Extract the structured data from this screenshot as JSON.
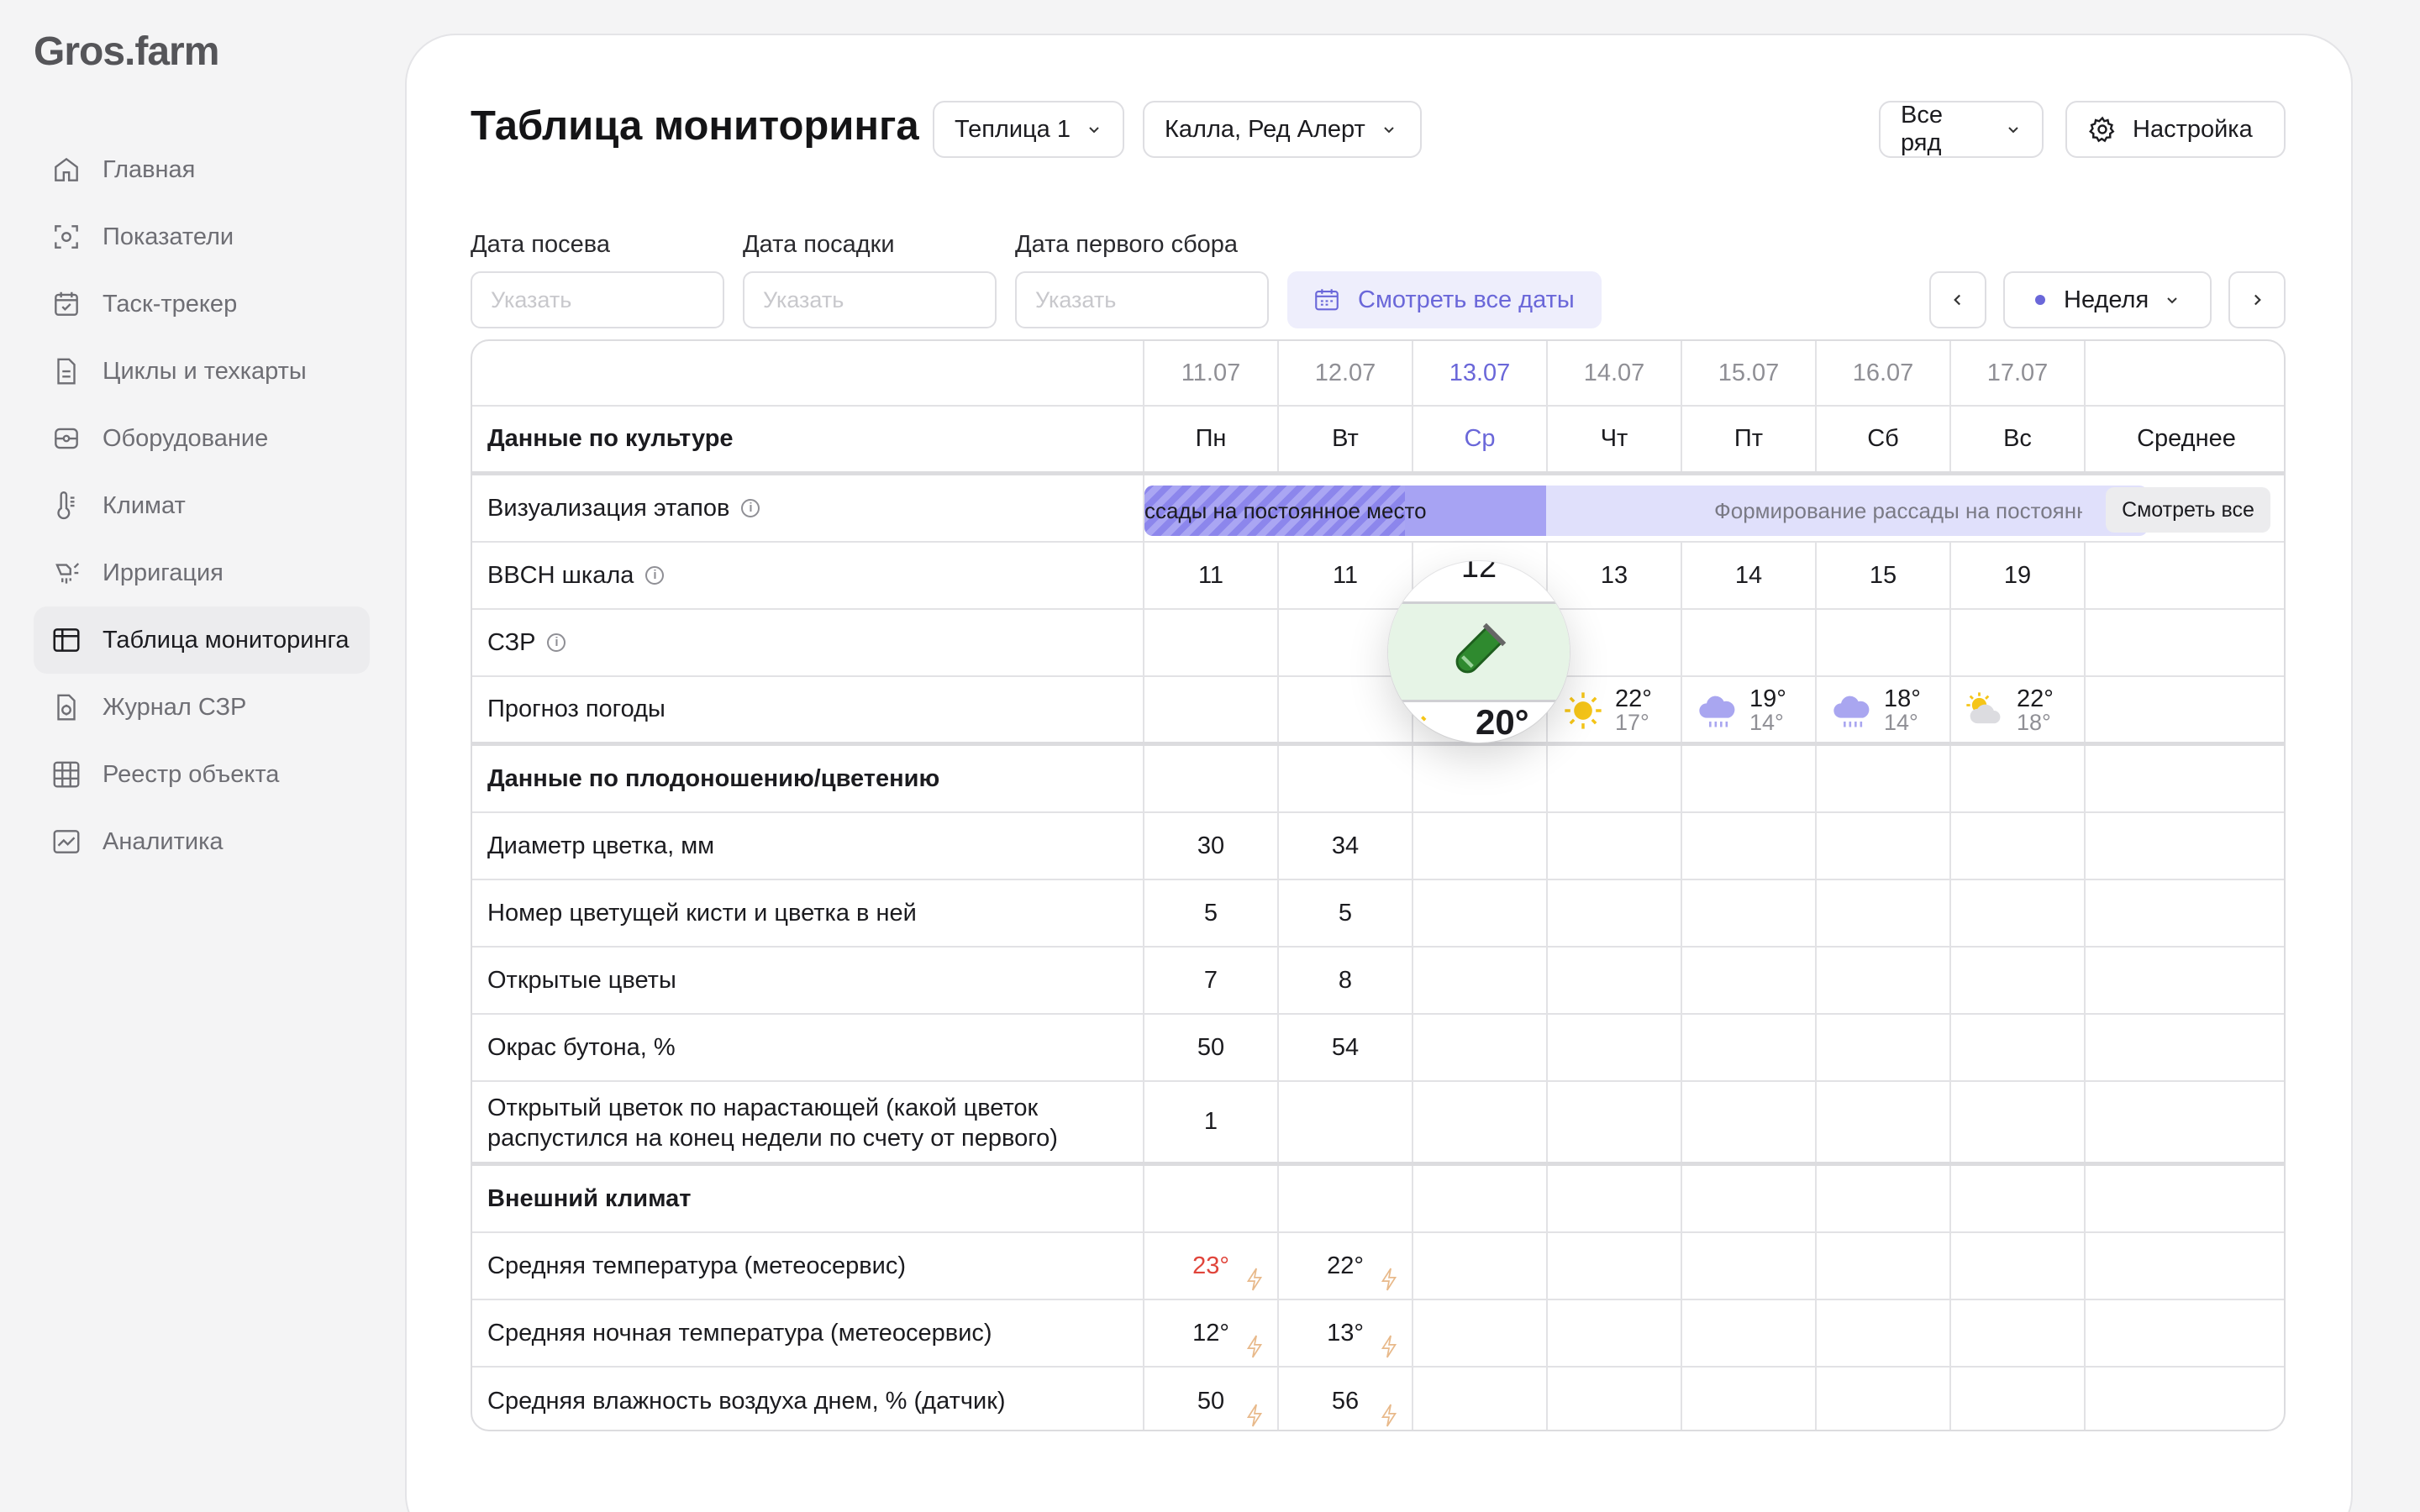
{
  "app": {
    "logo": "Gros.farm"
  },
  "sidebar": {
    "items": [
      {
        "label": "Главная",
        "icon": "home-icon"
      },
      {
        "label": "Показатели",
        "icon": "metrics-icon"
      },
      {
        "label": "Таск-трекер",
        "icon": "calendar-check-icon"
      },
      {
        "label": "Циклы и техкарты",
        "icon": "document-icon"
      },
      {
        "label": "Оборудование",
        "icon": "equipment-icon"
      },
      {
        "label": "Климат",
        "icon": "thermometer-icon"
      },
      {
        "label": "Ирригация",
        "icon": "irrigation-icon"
      },
      {
        "label": "Таблица мониторинга",
        "icon": "table-icon",
        "active": true
      },
      {
        "label": "Журнал СЗР",
        "icon": "journal-icon"
      },
      {
        "label": "Реестр объекта",
        "icon": "grid-icon"
      },
      {
        "label": "Аналитика",
        "icon": "chart-icon"
      }
    ]
  },
  "header": {
    "title": "Таблица мониторинга",
    "greenhouse": "Теплица 1",
    "crop": "Калла, Ред Алерт",
    "rows": "Все ряд",
    "settings": "Настройка"
  },
  "filters": {
    "sowing_label": "Дата посева",
    "planting_label": "Дата посадки",
    "harvest_label": "Дата первого сбора",
    "placeholder": "Указать",
    "all_dates": "Смотреть все даты",
    "period": "Неделя"
  },
  "table": {
    "dates": [
      "11.07",
      "12.07",
      "13.07",
      "14.07",
      "15.07",
      "16.07",
      "17.07"
    ],
    "weekdays": [
      "Пн",
      "Вт",
      "Ср",
      "Чт",
      "Пт",
      "Сб",
      "Вс"
    ],
    "current_day_index": 2,
    "avg_label": "Среднее",
    "section_culture": "Данные по культуре",
    "stage_label": "Визуализация этапов",
    "stage1_text": "ссады на постоянное место",
    "stage2_text": "Формирование  рассады на постоянн",
    "see_all": "Смотреть все",
    "bbch_label": "BBCH шкала",
    "bbch": [
      "11",
      "11",
      "12",
      "13",
      "14",
      "15",
      "19"
    ],
    "szr_label": "СЗР",
    "weather_label": "Прогноз погоды",
    "weather": [
      {
        "hi": "20°",
        "lo": "",
        "icon": "partly-sunny-icon"
      },
      {
        "hi": "22°",
        "lo": "17°",
        "icon": "sun-icon"
      },
      {
        "hi": "19°",
        "lo": "14°",
        "icon": "rain-cloud-icon"
      },
      {
        "hi": "18°",
        "lo": "14°",
        "icon": "rain-cloud-icon"
      },
      {
        "hi": "22°",
        "lo": "18°",
        "icon": "partly-cloudy-icon"
      }
    ],
    "section_fruit": "Данные по плодоношению/цветению",
    "flower_diameter": {
      "label": "Диаметр цветка, мм",
      "values": [
        "30",
        "34"
      ]
    },
    "flower_number": {
      "label": "Номер цветущей кисти и цветка в ней",
      "values": [
        "5",
        "5"
      ]
    },
    "open_flowers": {
      "label": "Открытые цветы",
      "values": [
        "7",
        "8"
      ]
    },
    "bud_color": {
      "label": "Окрас бутона, %",
      "values": [
        "50",
        "54"
      ]
    },
    "open_flower_cum": {
      "label_line1": "Открытый цветок по нарастающей (какой цветок",
      "label_line2": "распустился на конец недели по счету от первого)",
      "values": [
        "1"
      ]
    },
    "section_climate": "Внешний климат",
    "avg_temp": {
      "label": "Средняя температура (метеосервис)",
      "values": [
        "23°",
        "22°"
      ]
    },
    "avg_night_temp": {
      "label": "Средняя ночная температура (метеосервис)",
      "values": [
        "12°",
        "13°"
      ]
    },
    "avg_humidity": {
      "label": "Средняя влажность воздуха днем, % (датчик)",
      "values": [
        "50",
        "56"
      ]
    }
  },
  "colors": {
    "accent": "#6a67d9",
    "hot": "#e0443a",
    "stage": "#a7a3f3"
  }
}
